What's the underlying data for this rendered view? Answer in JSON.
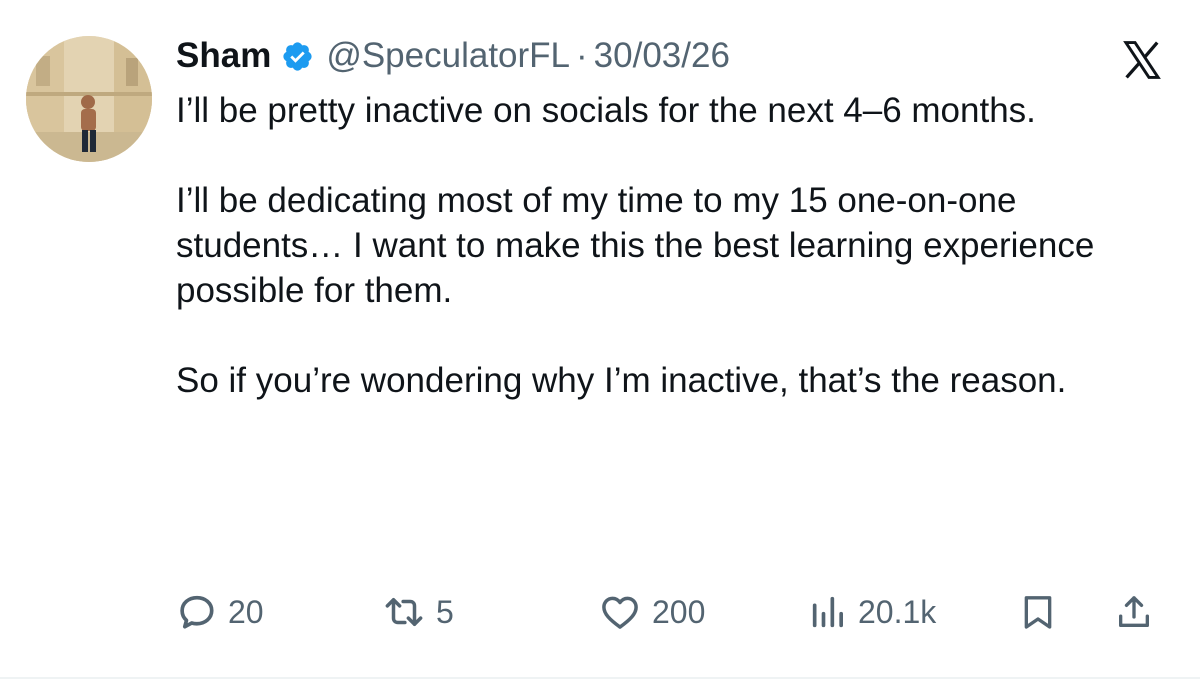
{
  "tweet": {
    "author_name": "Sham",
    "handle": "@SpeculatorFL",
    "separator": "·",
    "date": "30/03/26",
    "paragraphs": [
      "I’ll be pretty inactive on socials for the next 4–6 months.",
      "I’ll be dedicating most of my time to my 15 one-on-one students… I want to make this the best learning experience possible for them.",
      "So if you’re wondering why I’m inactive, that’s the reason."
    ]
  },
  "actions": {
    "replies": "20",
    "reposts": "5",
    "likes": "200",
    "views": "20.1k"
  },
  "icons": {
    "verified": "verified-badge-icon",
    "platform": "x-logo-icon",
    "reply": "reply-icon",
    "repost": "repost-icon",
    "like": "heart-icon",
    "views": "views-icon",
    "bookmark": "bookmark-icon",
    "share": "share-icon"
  },
  "colors": {
    "text": "#0f1419",
    "secondary": "#536471",
    "verified": "#1d9bf0"
  }
}
